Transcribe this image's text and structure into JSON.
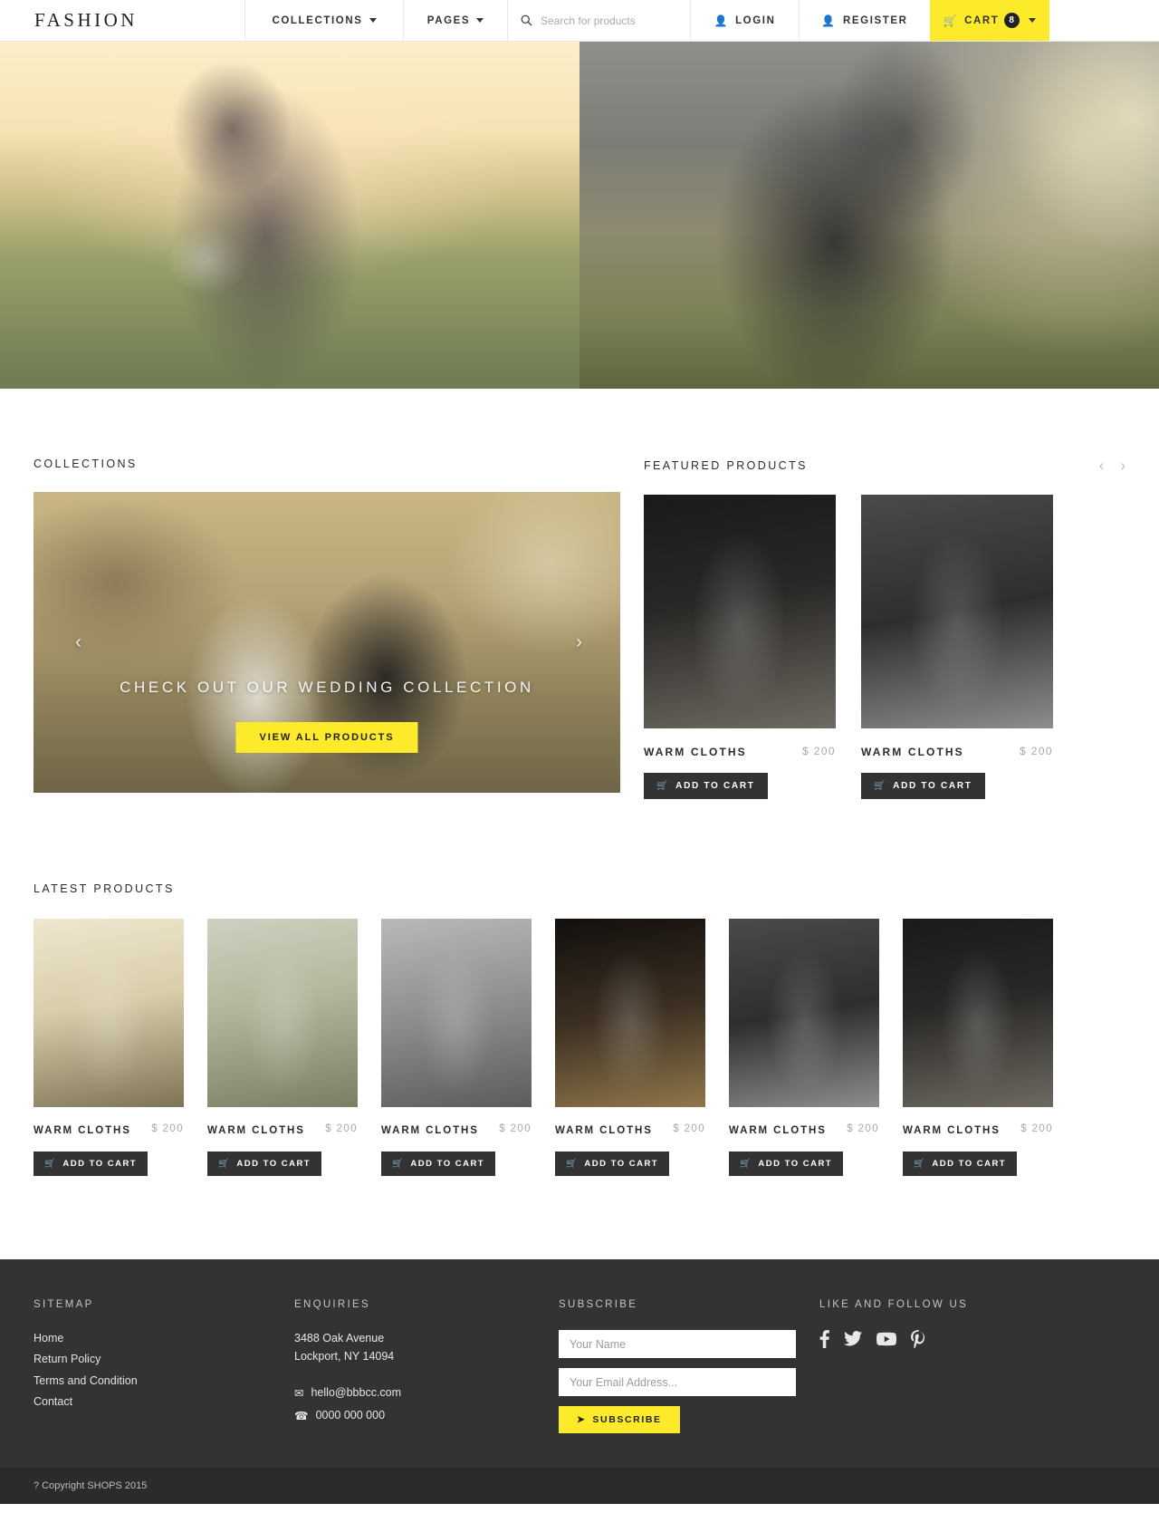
{
  "header": {
    "brand": "FASHION",
    "nav": [
      {
        "label": "COLLECTIONS",
        "icon": "chevron-down-icon"
      },
      {
        "label": "PAGES",
        "icon": "chevron-down-icon"
      }
    ],
    "search": {
      "placeholder": "Search for products",
      "value": "",
      "icon": "search-icon"
    },
    "login": {
      "label": "LOGIN",
      "icon": "user-icon"
    },
    "register": {
      "label": "REGISTER",
      "icon": "user-icon"
    },
    "cart": {
      "label": "CART",
      "count": "8",
      "icon": "cart-icon",
      "accent": "#fcea2b"
    }
  },
  "collections": {
    "title": "COLLECTIONS",
    "slide_caption": "CHECK OUT OUR WEDDING COLLECTION",
    "cta": "VIEW ALL PRODUCTS",
    "prev_icon": "chevron-left-icon",
    "next_icon": "chevron-right-icon"
  },
  "featured": {
    "title": "FEATURED PRODUCTS",
    "prev_icon": "chevron-left-icon",
    "next_icon": "chevron-right-icon",
    "products": [
      {
        "name": "WARM CLOTHS",
        "price": "$ 200",
        "cart_label": "ADD TO CART"
      },
      {
        "name": "WARM CLOTHS",
        "price": "$ 200",
        "cart_label": "ADD TO CART"
      }
    ]
  },
  "latest": {
    "title": "LATEST PRODUCTS",
    "products": [
      {
        "name": "WARM CLOTHS",
        "price": "$ 200",
        "cart_label": "ADD TO CART"
      },
      {
        "name": "WARM CLOTHS",
        "price": "$ 200",
        "cart_label": "ADD TO CART"
      },
      {
        "name": "WARM CLOTHS",
        "price": "$ 200",
        "cart_label": "ADD TO CART"
      },
      {
        "name": "WARM CLOTHS",
        "price": "$ 200",
        "cart_label": "ADD TO CART"
      },
      {
        "name": "WARM CLOTHS",
        "price": "$ 200",
        "cart_label": "ADD TO CART"
      },
      {
        "name": "WARM CLOTHS",
        "price": "$ 200",
        "cart_label": "ADD TO CART"
      }
    ]
  },
  "footer": {
    "sitemap": {
      "title": "SITEMAP",
      "links": [
        "Home",
        "Return Policy",
        "Terms and Condition",
        "Contact"
      ]
    },
    "enquiries": {
      "title": "ENQUIRIES",
      "address_line1": "3488 Oak Avenue",
      "address_line2": "Lockport, NY 14094",
      "email": "hello@bbbcc.com",
      "email_icon": "envelope-icon",
      "phone": "0000 000 000",
      "phone_icon": "phone-icon"
    },
    "subscribe": {
      "title": "SUBSCRIBE",
      "name_placeholder": "Your Name",
      "name_value": "",
      "email_placeholder": "Your Email Address...",
      "email_value": "",
      "button_label": "SUBSCRIBE",
      "button_icon": "paper-plane-icon"
    },
    "social": {
      "title": "LIKE AND FOLLOW US",
      "icons": [
        "facebook-icon",
        "twitter-icon",
        "youtube-icon",
        "pinterest-icon"
      ]
    },
    "copyright": "? Copyright SHOPS 2015"
  }
}
